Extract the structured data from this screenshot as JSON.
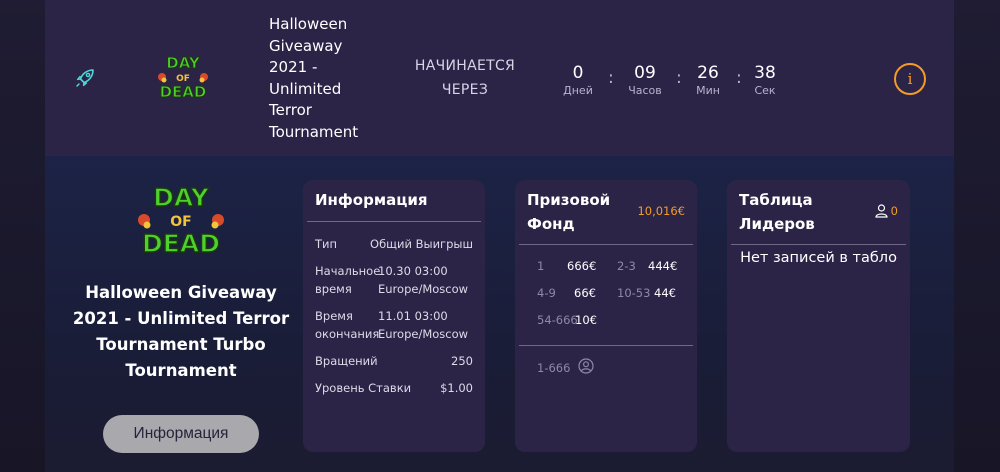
{
  "header": {
    "title": "Halloween Giveaway 2021 - Unlimited Terror Tournament",
    "starts_label": "НАЧИНАЕТСЯ ЧЕРЕЗ",
    "countdown": [
      {
        "value": "0",
        "label": "Дней"
      },
      {
        "value": "09",
        "label": "Часов"
      },
      {
        "value": "26",
        "label": "Мин"
      },
      {
        "value": "38",
        "label": "Сек"
      }
    ],
    "separator": ":",
    "info_icon": "i"
  },
  "logo": {
    "line1": "DAY",
    "line2": "OF",
    "line3": "DEAD"
  },
  "main": {
    "title": "Halloween Giveaway 2021 - Unlimited Terror Tournament Turbo Tournament",
    "info_button": "Информация"
  },
  "info_panel": {
    "title": "Информация",
    "rows": [
      {
        "key": "Тип",
        "value": "Общий Выигрыш"
      },
      {
        "key": "Начальное время",
        "value": "10.30 03:00 Europe/Moscow"
      },
      {
        "key": "Время окончания",
        "value": "11.01 03:00 Europe/Moscow"
      },
      {
        "key": "Вращений",
        "value": "250"
      },
      {
        "key": "Уровень Ставки",
        "value": "$1.00"
      }
    ]
  },
  "prize_panel": {
    "title": "Призовой Фонд",
    "amount": "10,016€",
    "prizes": [
      {
        "range": "1",
        "amount": "666€"
      },
      {
        "range": "2-3",
        "amount": "444€"
      },
      {
        "range": "4-9",
        "amount": "66€"
      },
      {
        "range": "10-53",
        "amount": "44€"
      },
      {
        "range": "54-666",
        "amount": "10€"
      }
    ],
    "footer_range": "1-666"
  },
  "leader_panel": {
    "title": "Таблица Лидеров",
    "count": "0",
    "empty_text": "Нет записей в табло"
  },
  "colors": {
    "header_bg": "#2c2447",
    "panel_bg": "#2b2447",
    "accent": "#f39c27",
    "page_bg": "#191729"
  }
}
